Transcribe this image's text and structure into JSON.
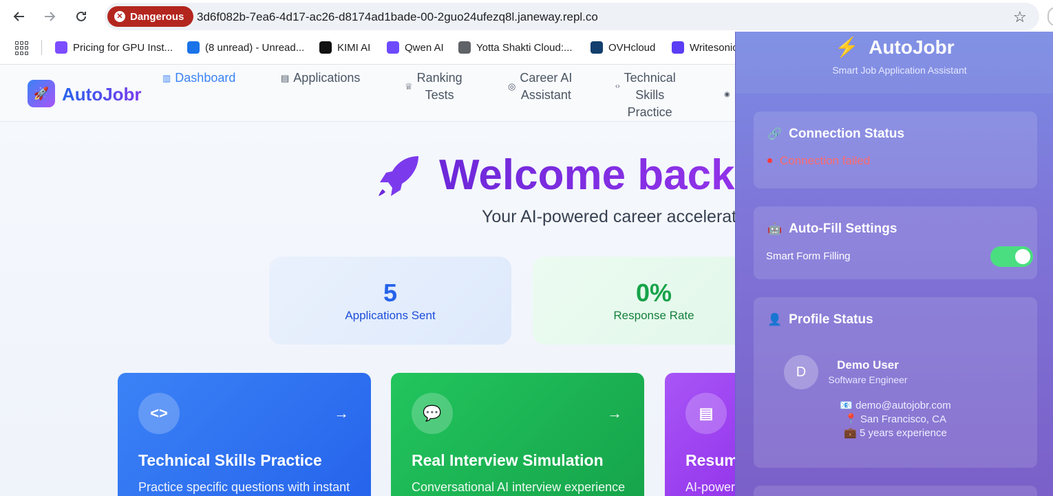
{
  "browser": {
    "security_chip": "Dangerous",
    "url": "3d6f082b-7ea6-4d17-ac26-d8174ad1bade-00-2guo24ufezq8l.janeway.repl.co",
    "bookmarks": [
      {
        "label": "Pricing for GPU Inst...",
        "icon": "box-icon",
        "color": "#7c4dff"
      },
      {
        "label": "(8 unread) - Unread...",
        "icon": "mail-icon",
        "color": "#1a73e8"
      },
      {
        "label": "KIMI AI",
        "icon": "kimi-icon",
        "color": "#111111"
      },
      {
        "label": "Qwen AI",
        "icon": "qwen-icon",
        "color": "#6d4aff"
      },
      {
        "label": "Yotta Shakti Cloud:...",
        "icon": "globe-icon",
        "color": "#5f6368"
      },
      {
        "label": "OVHcloud",
        "icon": "ovh-icon",
        "color": "#123f6d"
      },
      {
        "label": "Writesonic",
        "icon": "writesonic-icon",
        "color": "#5b3df5"
      }
    ]
  },
  "app": {
    "logo_text": "AutoJobr",
    "nav": [
      {
        "label": "Dashboard",
        "icon": "chart-icon",
        "active": true
      },
      {
        "label": "Applications",
        "icon": "document-icon"
      },
      {
        "label": "Ranking\nTests",
        "icon": "trophy-icon"
      },
      {
        "label": "Career AI\nAssistant",
        "icon": "brain-icon"
      },
      {
        "label": "Technical\nSkills\nPractice",
        "icon": "code-icon"
      },
      {
        "label": "",
        "icon": "info-icon"
      }
    ],
    "welcome": "Welcome back,",
    "subtitle": "Your AI-powered career accelerati",
    "stats": [
      {
        "value": "5",
        "label": "Applications Sent"
      },
      {
        "value": "0%",
        "label": "Response Rate"
      }
    ],
    "cards": [
      {
        "title": "Technical Skills Practice",
        "desc": "Practice specific questions with instant",
        "icon": "code-icon"
      },
      {
        "title": "Real Interview Simulation",
        "desc": "Conversational AI interview experience",
        "icon": "chat-icon"
      },
      {
        "title": "Resume",
        "desc": "AI-power",
        "icon": "file-icon"
      }
    ]
  },
  "extension": {
    "title": "AutoJobr",
    "subtitle": "Smart Job Application Assistant",
    "connection": {
      "title": "Connection Status",
      "status": "Connection failed"
    },
    "autofill": {
      "title": "Auto-Fill Settings",
      "setting_label": "Smart Form Filling",
      "enabled": true
    },
    "profile": {
      "title": "Profile Status",
      "initial": "D",
      "name": "Demo User",
      "role": "Software Engineer",
      "email": "demo@autojobr.com",
      "location": "San Francisco, CA",
      "experience": "5 years experience"
    }
  },
  "colors": {
    "danger": "#b3261e",
    "brand_blue": "#2563eb",
    "brand_purple": "#7c3aed",
    "card_blue": "#3b82f6",
    "card_green": "#22c55e",
    "card_purple": "#a855f7",
    "status_error": "#ff6b6b",
    "toggle_on": "#4ade80"
  }
}
